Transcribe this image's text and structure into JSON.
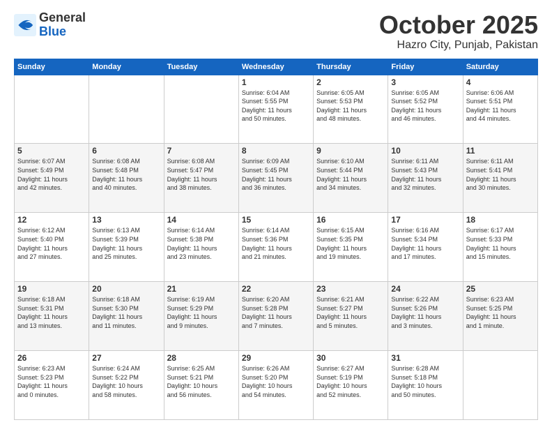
{
  "logo": {
    "general": "General",
    "blue": "Blue"
  },
  "header": {
    "month": "October 2025",
    "location": "Hazro City, Punjab, Pakistan"
  },
  "days_of_week": [
    "Sunday",
    "Monday",
    "Tuesday",
    "Wednesday",
    "Thursday",
    "Friday",
    "Saturday"
  ],
  "weeks": [
    [
      {
        "day": "",
        "info": ""
      },
      {
        "day": "",
        "info": ""
      },
      {
        "day": "",
        "info": ""
      },
      {
        "day": "1",
        "info": "Sunrise: 6:04 AM\nSunset: 5:55 PM\nDaylight: 11 hours\nand 50 minutes."
      },
      {
        "day": "2",
        "info": "Sunrise: 6:05 AM\nSunset: 5:53 PM\nDaylight: 11 hours\nand 48 minutes."
      },
      {
        "day": "3",
        "info": "Sunrise: 6:05 AM\nSunset: 5:52 PM\nDaylight: 11 hours\nand 46 minutes."
      },
      {
        "day": "4",
        "info": "Sunrise: 6:06 AM\nSunset: 5:51 PM\nDaylight: 11 hours\nand 44 minutes."
      }
    ],
    [
      {
        "day": "5",
        "info": "Sunrise: 6:07 AM\nSunset: 5:49 PM\nDaylight: 11 hours\nand 42 minutes."
      },
      {
        "day": "6",
        "info": "Sunrise: 6:08 AM\nSunset: 5:48 PM\nDaylight: 11 hours\nand 40 minutes."
      },
      {
        "day": "7",
        "info": "Sunrise: 6:08 AM\nSunset: 5:47 PM\nDaylight: 11 hours\nand 38 minutes."
      },
      {
        "day": "8",
        "info": "Sunrise: 6:09 AM\nSunset: 5:45 PM\nDaylight: 11 hours\nand 36 minutes."
      },
      {
        "day": "9",
        "info": "Sunrise: 6:10 AM\nSunset: 5:44 PM\nDaylight: 11 hours\nand 34 minutes."
      },
      {
        "day": "10",
        "info": "Sunrise: 6:11 AM\nSunset: 5:43 PM\nDaylight: 11 hours\nand 32 minutes."
      },
      {
        "day": "11",
        "info": "Sunrise: 6:11 AM\nSunset: 5:41 PM\nDaylight: 11 hours\nand 30 minutes."
      }
    ],
    [
      {
        "day": "12",
        "info": "Sunrise: 6:12 AM\nSunset: 5:40 PM\nDaylight: 11 hours\nand 27 minutes."
      },
      {
        "day": "13",
        "info": "Sunrise: 6:13 AM\nSunset: 5:39 PM\nDaylight: 11 hours\nand 25 minutes."
      },
      {
        "day": "14",
        "info": "Sunrise: 6:14 AM\nSunset: 5:38 PM\nDaylight: 11 hours\nand 23 minutes."
      },
      {
        "day": "15",
        "info": "Sunrise: 6:14 AM\nSunset: 5:36 PM\nDaylight: 11 hours\nand 21 minutes."
      },
      {
        "day": "16",
        "info": "Sunrise: 6:15 AM\nSunset: 5:35 PM\nDaylight: 11 hours\nand 19 minutes."
      },
      {
        "day": "17",
        "info": "Sunrise: 6:16 AM\nSunset: 5:34 PM\nDaylight: 11 hours\nand 17 minutes."
      },
      {
        "day": "18",
        "info": "Sunrise: 6:17 AM\nSunset: 5:33 PM\nDaylight: 11 hours\nand 15 minutes."
      }
    ],
    [
      {
        "day": "19",
        "info": "Sunrise: 6:18 AM\nSunset: 5:31 PM\nDaylight: 11 hours\nand 13 minutes."
      },
      {
        "day": "20",
        "info": "Sunrise: 6:18 AM\nSunset: 5:30 PM\nDaylight: 11 hours\nand 11 minutes."
      },
      {
        "day": "21",
        "info": "Sunrise: 6:19 AM\nSunset: 5:29 PM\nDaylight: 11 hours\nand 9 minutes."
      },
      {
        "day": "22",
        "info": "Sunrise: 6:20 AM\nSunset: 5:28 PM\nDaylight: 11 hours\nand 7 minutes."
      },
      {
        "day": "23",
        "info": "Sunrise: 6:21 AM\nSunset: 5:27 PM\nDaylight: 11 hours\nand 5 minutes."
      },
      {
        "day": "24",
        "info": "Sunrise: 6:22 AM\nSunset: 5:26 PM\nDaylight: 11 hours\nand 3 minutes."
      },
      {
        "day": "25",
        "info": "Sunrise: 6:23 AM\nSunset: 5:25 PM\nDaylight: 11 hours\nand 1 minute."
      }
    ],
    [
      {
        "day": "26",
        "info": "Sunrise: 6:23 AM\nSunset: 5:23 PM\nDaylight: 11 hours\nand 0 minutes."
      },
      {
        "day": "27",
        "info": "Sunrise: 6:24 AM\nSunset: 5:22 PM\nDaylight: 10 hours\nand 58 minutes."
      },
      {
        "day": "28",
        "info": "Sunrise: 6:25 AM\nSunset: 5:21 PM\nDaylight: 10 hours\nand 56 minutes."
      },
      {
        "day": "29",
        "info": "Sunrise: 6:26 AM\nSunset: 5:20 PM\nDaylight: 10 hours\nand 54 minutes."
      },
      {
        "day": "30",
        "info": "Sunrise: 6:27 AM\nSunset: 5:19 PM\nDaylight: 10 hours\nand 52 minutes."
      },
      {
        "day": "31",
        "info": "Sunrise: 6:28 AM\nSunset: 5:18 PM\nDaylight: 10 hours\nand 50 minutes."
      },
      {
        "day": "",
        "info": ""
      }
    ]
  ]
}
